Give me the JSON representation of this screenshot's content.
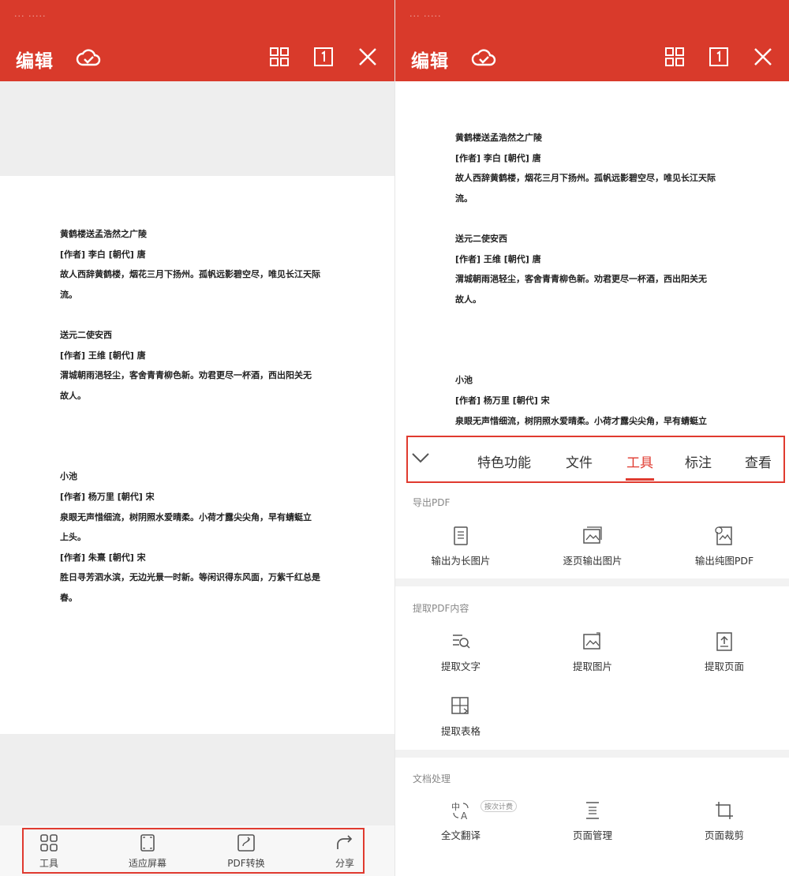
{
  "status_bar": {
    "text": "···  ·····"
  },
  "left": {
    "header": {
      "edit_label": "编辑"
    },
    "icons": {
      "cloud": "cloud-check-icon",
      "grid": "grid-icon",
      "single": "single-page-icon",
      "close": "close-icon"
    },
    "doc_lines": [
      "黄鹤楼送孟浩然之广陵",
      "[作者] 李白 [朝代] 唐",
      "故人西辞黄鹤楼，烟花三月下扬州。孤帆远影碧空尽，唯见长江天际",
      "流。",
      "送元二使安西",
      "[作者] 王维 [朝代] 唐",
      "渭城朝雨浥轻尘，客舍青青柳色新。劝君更尽一杯酒，西出阳关无",
      "故人。",
      "小池",
      "[作者] 杨万里 [朝代] 宋",
      "泉眼无声惜细流，树阴照水爱晴柔。小荷才露尖尖角，早有蜻蜓立",
      "上头。",
      "[作者] 朱熹 [朝代] 宋",
      "胜日寻芳泗水滨，无边光景一时新。等闲识得东风面，万紫千红总是",
      "春。"
    ],
    "bottom_bar": [
      {
        "label": "工具",
        "icon": "tools-grid-icon"
      },
      {
        "label": "适应屏幕",
        "icon": "fit-screen-icon"
      },
      {
        "label": "PDF转换",
        "icon": "pdf-convert-icon"
      },
      {
        "label": "分享",
        "icon": "share-icon"
      }
    ]
  },
  "right": {
    "header": {
      "edit_label": "编辑"
    },
    "doc_lines": [
      "黄鹤楼送孟浩然之广陵",
      "[作者] 李白 [朝代] 唐",
      "故人西辞黄鹤楼，烟花三月下扬州。孤帆远影碧空尽，唯见长江天际",
      "流。",
      "送元二使安西",
      "[作者] 王维 [朝代] 唐",
      "渭城朝雨浥轻尘，客舍青青柳色新。劝君更尽一杯酒，西出阳关无",
      "故人。",
      "小池",
      "[作者] 杨万里 [朝代] 宋",
      "泉眼无声惜细流，树阴照水爱晴柔。小荷才露尖尖角，早有蜻蜓立"
    ],
    "tabs": [
      {
        "label": "特色功能",
        "active": false
      },
      {
        "label": "文件",
        "active": false
      },
      {
        "label": "工具",
        "active": true
      },
      {
        "label": "标注",
        "active": false
      },
      {
        "label": "查看",
        "active": false
      }
    ],
    "sections": [
      {
        "title": "导出PDF",
        "tools": [
          {
            "label": "输出为长图片",
            "icon": "long-image-icon"
          },
          {
            "label": "逐页输出图片",
            "icon": "page-image-icon"
          },
          {
            "label": "输出纯图PDF",
            "icon": "image-pdf-icon"
          }
        ]
      },
      {
        "title": "提取PDF内容",
        "tools": [
          {
            "label": "提取文字",
            "icon": "extract-text-icon"
          },
          {
            "label": "提取图片",
            "icon": "extract-image-icon"
          },
          {
            "label": "提取页面",
            "icon": "extract-page-icon"
          },
          {
            "label": "提取表格",
            "icon": "extract-table-icon"
          }
        ]
      },
      {
        "title": "文档处理",
        "tools": [
          {
            "label": "全文翻译",
            "icon": "translate-icon",
            "badge": "按次计费"
          },
          {
            "label": "页面管理",
            "icon": "page-manage-icon"
          },
          {
            "label": "页面裁剪",
            "icon": "page-crop-icon"
          }
        ]
      }
    ]
  },
  "colors": {
    "brand_red": "#d93a2b",
    "highlight_red": "#e03a2f",
    "active_tab": "#e03a2f"
  }
}
